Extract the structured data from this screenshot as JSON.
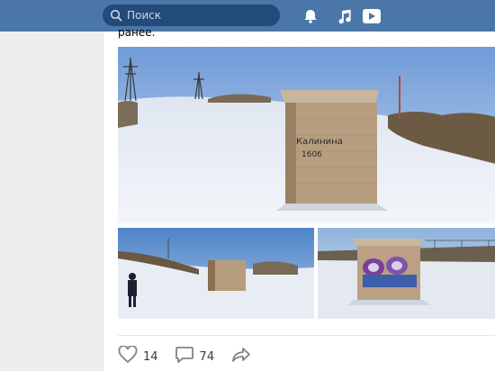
{
  "header": {
    "search": {
      "placeholder": "Поиск",
      "icon": "search-icon"
    },
    "icons": [
      "bell-icon",
      "music-icon",
      "video-icon"
    ]
  },
  "post": {
    "text_fragment": "ранее.",
    "photo_1_graffiti": "Калинина\n1606",
    "actions": {
      "likes": "14",
      "comments": "74",
      "share_icon": "share-icon"
    }
  },
  "colors": {
    "header_bg": "#4a76a8",
    "search_bg": "#224b7a",
    "page_bg": "#edeef0"
  }
}
